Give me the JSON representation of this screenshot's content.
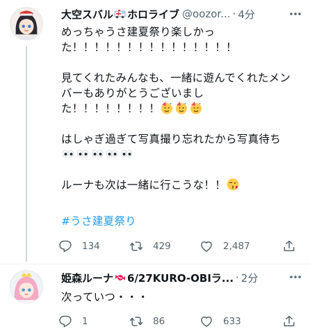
{
  "tweets": [
    {
      "author_name": "大空スバル",
      "author_name_suffix": "ホロライブ",
      "handle": "@oozor...",
      "dot": "·",
      "time": "4分",
      "body_paragraphs": [
        "めっちゃうさ建夏祭り楽しかった！！！！！！！！！！！！！！！",
        "",
        "見てくれたみんなも、一緒に遊んでくれたメンバーもありがとうございました！！！！！！！！",
        "",
        "はしゃぎ過ぎて写真撮り忘れたから写真待ち",
        "",
        "ルーナも次は一緒に行こうな！！"
      ],
      "hashtag": "#うさ建夏祭り",
      "replies": "134",
      "retweets": "429",
      "likes": "2,487"
    },
    {
      "author_name": "姫森ルーナ",
      "author_name_suffix": "6/27KURO-OBIラ...",
      "dot": "·",
      "time": "2分",
      "body": "次っていつ・・・",
      "replies": "1",
      "retweets": "86",
      "likes": "633"
    }
  ],
  "icons": {
    "reply": "reply-icon",
    "retweet": "retweet-icon",
    "like": "heart-icon",
    "share": "share-icon",
    "more": "more-icon"
  },
  "colors": {
    "text": "#0f1419",
    "secondary": "#536471",
    "link": "#1d9bf0",
    "divider": "#eff3f4"
  }
}
